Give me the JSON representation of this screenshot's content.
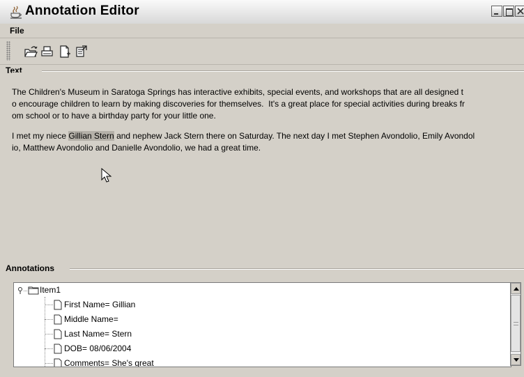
{
  "window": {
    "title": "Annotation Editor"
  },
  "menu": {
    "file": "File"
  },
  "toolbar": {
    "icons": [
      "open-folder-icon",
      "print-icon",
      "new-document-icon",
      "export-icon"
    ]
  },
  "text_section": {
    "title": "Text",
    "paragraph1": "The Children's Museum in Saratoga Springs has interactive exhibits, special events, and workshops that are all designed t\no encourage children to learn by making discoveries for themselves.  It's a great place for special activities during breaks fr\nom school or to have a birthday party for your little one.",
    "p2_before": "I met my niece ",
    "p2_highlight": "Gillian Stern",
    "p2_after": " and nephew Jack Stern there on Saturday. The next day I met Stephen Avondolio, Emily Avondol\nio, Matthew Avondolio and Danielle Avondolio, we had a great time."
  },
  "annotations_section": {
    "title": "Annotations",
    "root": "Item1",
    "fields": [
      "First Name= Gillian",
      "Middle Name=",
      "Last Name= Stern",
      "DOB= 08/06/2004",
      "Comments= She's great"
    ]
  }
}
